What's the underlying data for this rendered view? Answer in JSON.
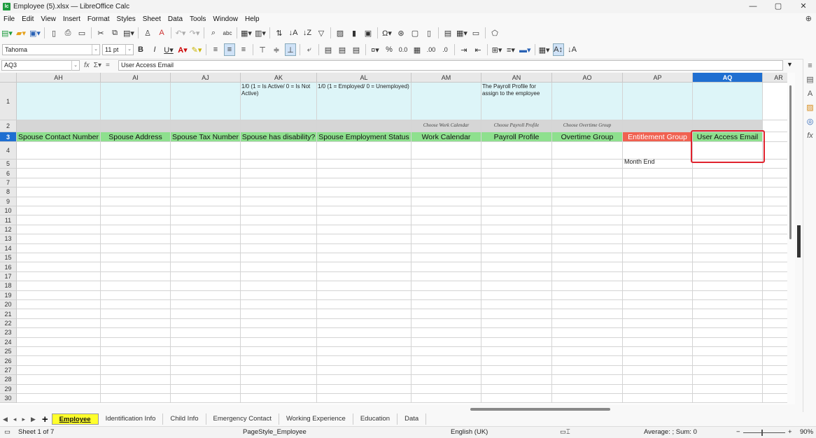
{
  "window": {
    "title": "Employee (5).xlsx — LibreOffice Calc",
    "app_icon_text": "lc",
    "min": "—",
    "max": "▢",
    "close": "✕"
  },
  "menu": [
    "File",
    "Edit",
    "View",
    "Insert",
    "Format",
    "Styles",
    "Sheet",
    "Data",
    "Tools",
    "Window",
    "Help"
  ],
  "toolbar2": {
    "font_name": "Tahoma",
    "font_size": "11 pt"
  },
  "formula_bar": {
    "name_box": "AQ3",
    "content": "User Access Email"
  },
  "columns": [
    {
      "name": "AH"
    },
    {
      "name": "AI"
    },
    {
      "name": "AJ"
    },
    {
      "name": "AK"
    },
    {
      "name": "AL"
    },
    {
      "name": "AM"
    },
    {
      "name": "AN"
    },
    {
      "name": "AO"
    },
    {
      "name": "AP"
    },
    {
      "name": "AQ",
      "selected": true
    },
    {
      "name": "AR"
    }
  ],
  "rows": [
    "1",
    "2",
    "3",
    "4",
    "5",
    "6",
    "7",
    "8",
    "9",
    "10",
    "11",
    "12",
    "13",
    "14",
    "15",
    "16",
    "17",
    "18",
    "19",
    "20",
    "21",
    "22",
    "23",
    "24",
    "25",
    "26",
    "27",
    "28",
    "29",
    "30"
  ],
  "row1": [
    "",
    "",
    "",
    "1/0 (1 = Is Active/ 0 = Is Not Active)",
    "1/0 (1 = Employed/ 0 = Unemployed)",
    "",
    "The Payroll Profile for assign to the employee",
    "",
    "",
    ""
  ],
  "row2": [
    "",
    "",
    "",
    "",
    "",
    "Choose Work Calendar",
    "Choose Payroll Profile",
    "Choose Overtime Group",
    "",
    ""
  ],
  "row3": [
    "Spouse Contact Number",
    "Spouse Address",
    "Spouse Tax Number",
    "Spouse has disability?",
    "Spouse Employment Status",
    "Work Calendar",
    "Payroll Profile",
    "Overtime Group",
    "Entitlement Group",
    "User Access Email"
  ],
  "row4_ap": "Month End",
  "sheet_tabs": [
    "Employee",
    "Identification Info",
    "Child Info",
    "Emergency Contact",
    "Working Experience",
    "Education",
    "Data"
  ],
  "active_tab": "Employee",
  "status": {
    "sheet": "Sheet 1 of 7",
    "page_style": "PageStyle_Employee",
    "language": "English (UK)",
    "sum": "Average: ; Sum: 0",
    "zoom": "90%"
  },
  "colors": {
    "header_cyan": "#ddf5f8",
    "header_green": "#8ee08e",
    "entitlement_red": "#f06150",
    "selection_blue": "#1f6fd1",
    "highlight_red": "#e0232e"
  }
}
